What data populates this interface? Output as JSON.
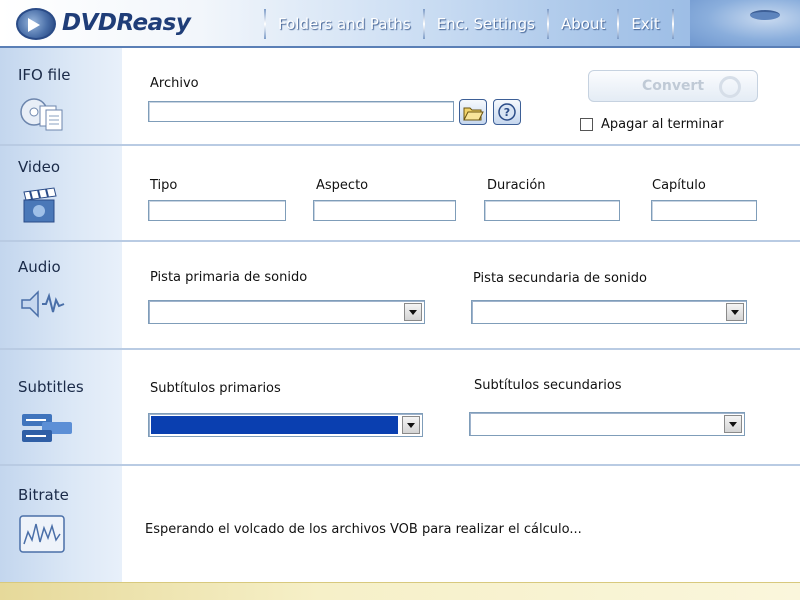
{
  "app": {
    "name": "DVDReasy"
  },
  "nav": [
    "Folders and Paths",
    "Enc. Settings",
    "About",
    "Exit"
  ],
  "sidebar": {
    "ifo": "IFO file",
    "video": "Video",
    "audio": "Audio",
    "subtitles": "Subtitles",
    "bitrate": "Bitrate"
  },
  "ifo_section": {
    "archivo_label": "Archivo",
    "archivo_value": "",
    "convert_label": "Convert",
    "shutdown_label": "Apagar al terminar",
    "shutdown_checked": false
  },
  "video_section": {
    "tipo": "Tipo",
    "aspecto": "Aspecto",
    "duracion": "Duración",
    "capitulo": "Capítulo"
  },
  "audio_section": {
    "primary": "Pista primaria de sonido",
    "secondary": "Pista secundaria de sonido"
  },
  "subtitles_section": {
    "primary": "Subtítulos primarios",
    "secondary": "Subtítulos secundarios"
  },
  "bitrate_section": {
    "status": "Esperando el volcado de los archivos VOB para realizar el cálculo..."
  },
  "colors": {
    "brand": "#1f3d78",
    "sidebar": "#dce8f6",
    "selection": "#0a3fb0"
  }
}
